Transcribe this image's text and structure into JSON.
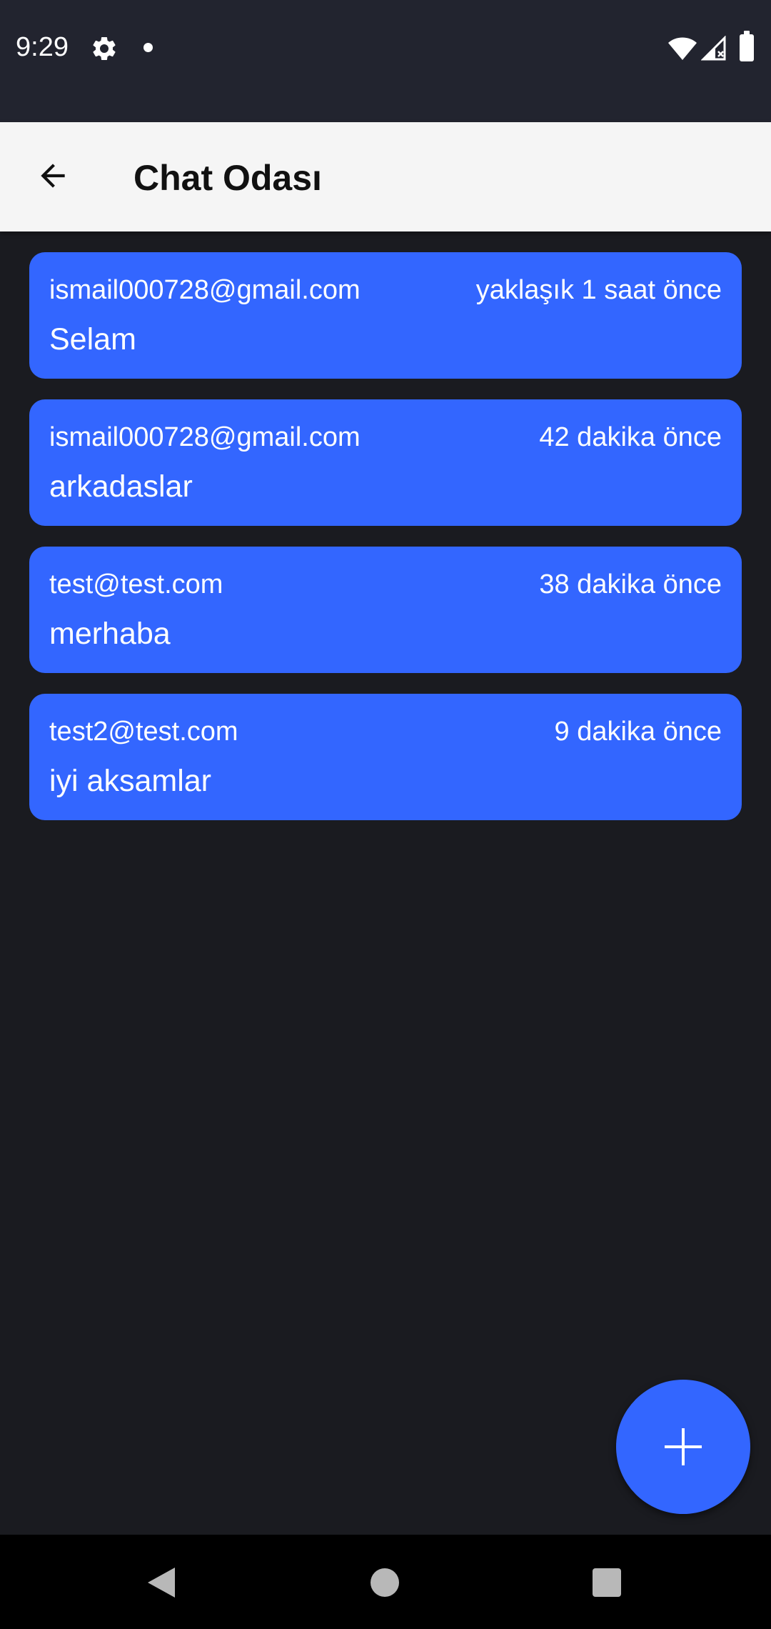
{
  "status_bar": {
    "time": "9:29",
    "icons": [
      "gear-icon",
      "notification-dot-icon",
      "wifi-icon",
      "signal-icon",
      "battery-icon"
    ]
  },
  "app_bar": {
    "title": "Chat Odası",
    "back_icon": "arrow-back-icon"
  },
  "messages": [
    {
      "sender": "ismail000728@gmail.com",
      "time": "yaklaşık 1 saat önce",
      "text": "Selam"
    },
    {
      "sender": "ismail000728@gmail.com",
      "time": "42 dakika önce",
      "text": "arkadaslar"
    },
    {
      "sender": "test@test.com",
      "time": "38 dakika önce",
      "text": "merhaba"
    },
    {
      "sender": "test2@test.com",
      "time": "9 dakika önce",
      "text": "iyi aksamlar"
    }
  ],
  "fab": {
    "icon": "plus-icon"
  },
  "nav_bar": {
    "icons": [
      "nav-back-icon",
      "nav-home-icon",
      "nav-recents-icon"
    ]
  },
  "colors": {
    "accent": "#3366ff",
    "background": "#1a1b20",
    "status_bar": "#22242f",
    "app_bar": "#f5f5f5"
  }
}
